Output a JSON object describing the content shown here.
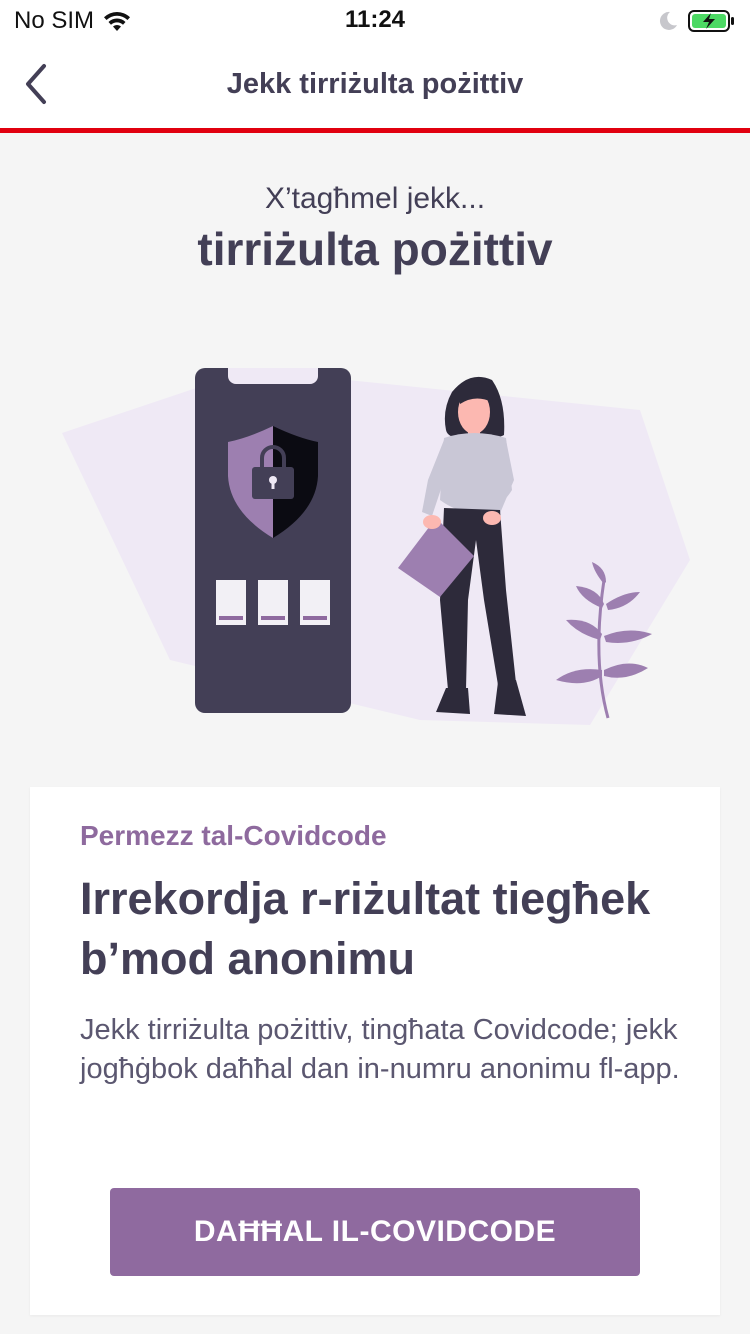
{
  "status_bar": {
    "carrier": "No SIM",
    "time": "11:24",
    "icons": [
      "wifi-icon",
      "moon-icon",
      "battery-charging-icon"
    ]
  },
  "nav": {
    "title": "Jekk tirriżulta pożittiv",
    "back_icon": "chevron-left-icon",
    "accent_color": "#e1000f"
  },
  "hero": {
    "subtitle": "X’tagħmel jekk...",
    "title": "tirriżulta pożittiv",
    "illustration": "phone-shield-lock-woman-with-document-illustration"
  },
  "card": {
    "eyebrow": "Permezz tal-Covidcode",
    "heading": "Irrekordja r-riżultat tiegħek b’mod anonimu",
    "body": "Jekk tirriżulta pożittiv, tingħata Covidcode; jekk jogħġbok daħħal dan in-numru anonimu fl-app.",
    "cta_label": "DAĦĦAL IL-COVIDCODE"
  },
  "colors": {
    "primary_purple": "#8f6a9f",
    "text_dark": "#433f56",
    "background": "#f5f5f5"
  }
}
